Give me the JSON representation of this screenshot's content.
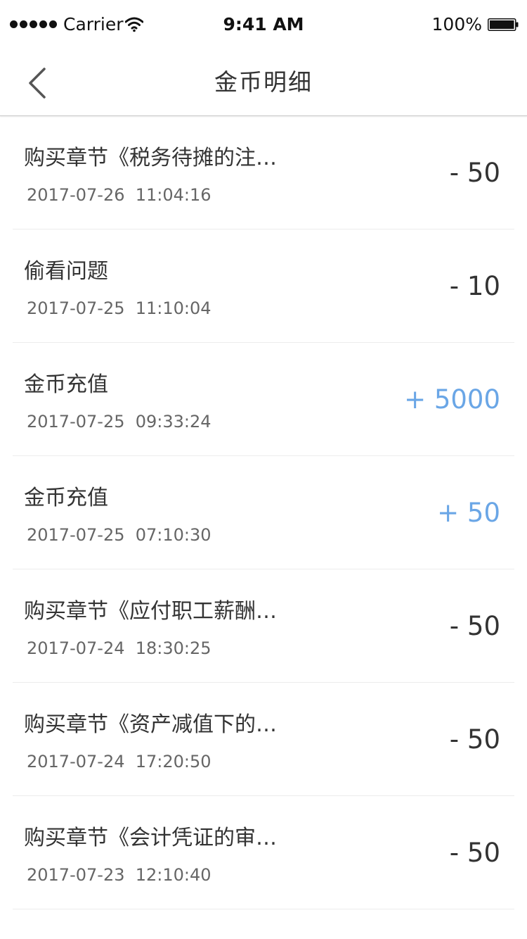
{
  "status_bar": {
    "carrier": "Carrier",
    "time": "9:41 AM",
    "battery": "100%"
  },
  "nav": {
    "title": "金币明细",
    "back_icon": "chevron-left-icon"
  },
  "colors": {
    "income": "#6aa6e6",
    "expense": "#333333",
    "divider": "#ececec"
  },
  "records": [
    {
      "title": "购买章节《税务待摊的注…",
      "datetime": "2017-07-26  11:04:16",
      "amount": "- 50",
      "type": "expense"
    },
    {
      "title": "偷看问题",
      "datetime": "2017-07-25  11:10:04",
      "amount": "- 10",
      "type": "expense"
    },
    {
      "title": "金币充值",
      "datetime": "2017-07-25  09:33:24",
      "amount": "+ 5000",
      "type": "income"
    },
    {
      "title": "金币充值",
      "datetime": "2017-07-25  07:10:30",
      "amount": "+ 50",
      "type": "income"
    },
    {
      "title": "购买章节《应付职工薪酬…",
      "datetime": "2017-07-24  18:30:25",
      "amount": "- 50",
      "type": "expense"
    },
    {
      "title": "购买章节《资产减值下的…",
      "datetime": "2017-07-24  17:20:50",
      "amount": "- 50",
      "type": "expense"
    },
    {
      "title": "购买章节《会计凭证的审…",
      "datetime": "2017-07-23  12:10:40",
      "amount": "- 50",
      "type": "expense"
    }
  ]
}
